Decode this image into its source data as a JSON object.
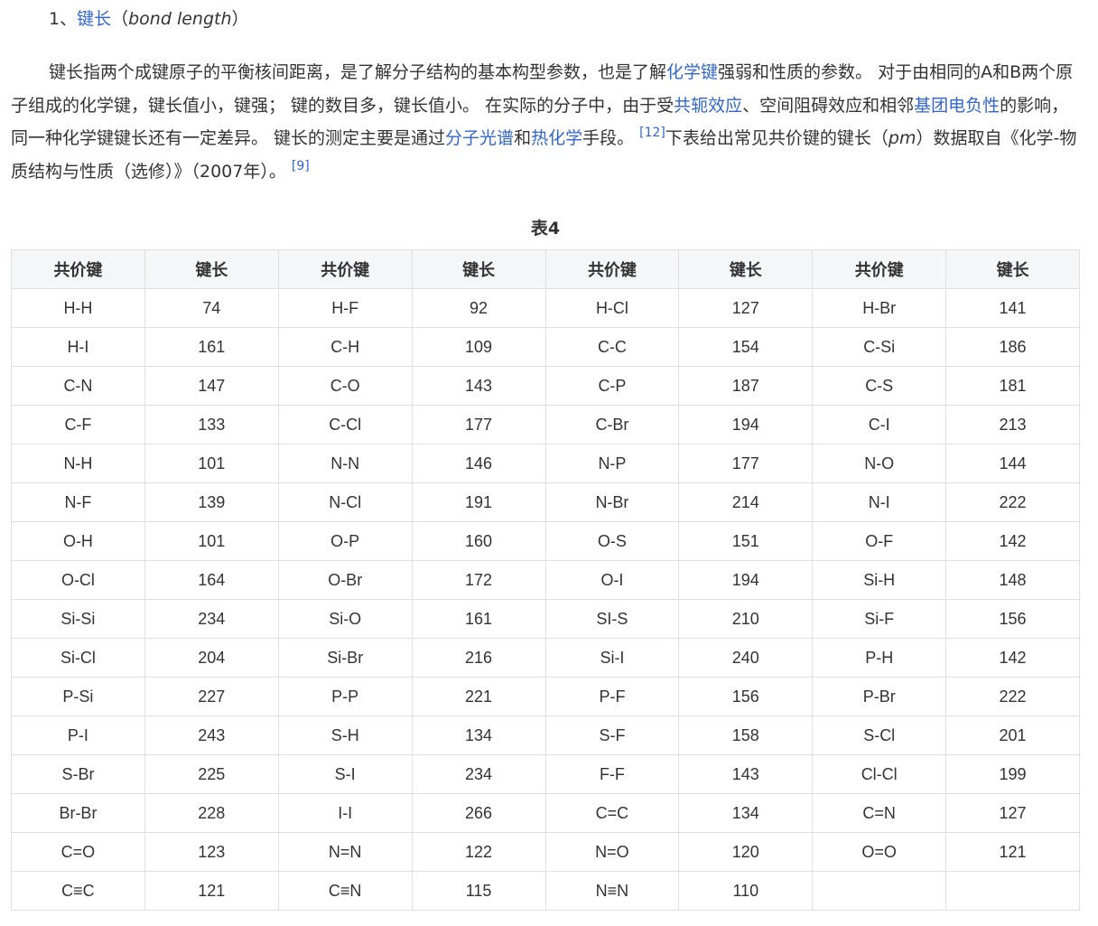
{
  "heading": {
    "number": "1、",
    "link": "键长",
    "open_paren": "（",
    "english": "bond length",
    "close_paren": "）"
  },
  "paragraph": {
    "t1": "键长指两个成键原子的平衡核间距离，是了解分子结构的基本构型参数，也是了解",
    "link1": "化学键",
    "t2": "强弱和性质的参数。 对于由相同的A和B两个原子组成的化学键，键长值小，键强； 键的数目多，键长值小。 在实际的分子中，由于受",
    "link2": "共轭效应",
    "t3": "、空间阻碍效应和相邻",
    "link3": "基团电负性",
    "t4": "的影响，同一种化学键键长还有一定差异。 键长的测定主要是通过",
    "link4": "分子光谱",
    "t5": "和",
    "link5": "热化学",
    "t6": "手段。 ",
    "ref1": "[12]",
    "t7": "下表给出常见共价键的键长（",
    "t7_italic": "pm",
    "t8": "）数据取自《化学-物质结构与性质（选修）》（2007年）。 ",
    "ref2": "[9]"
  },
  "table": {
    "caption": "表4",
    "headers": [
      "共价键",
      "键长",
      "共价键",
      "键长",
      "共价键",
      "键长",
      "共价键",
      "键长"
    ],
    "rows": [
      [
        "H-H",
        "74",
        "H-F",
        "92",
        "H-Cl",
        "127",
        "H-Br",
        "141"
      ],
      [
        "H-I",
        "161",
        "C-H",
        "109",
        "C-C",
        "154",
        "C-Si",
        "186"
      ],
      [
        "C-N",
        "147",
        "C-O",
        "143",
        "C-P",
        "187",
        "C-S",
        "181"
      ],
      [
        "C-F",
        "133",
        "C-Cl",
        "177",
        "C-Br",
        "194",
        "C-I",
        "213"
      ],
      [
        "N-H",
        "101",
        "N-N",
        "146",
        "N-P",
        "177",
        "N-O",
        "144"
      ],
      [
        "N-F",
        "139",
        "N-Cl",
        "191",
        "N-Br",
        "214",
        "N-I",
        "222"
      ],
      [
        "O-H",
        "101",
        "O-P",
        "160",
        "O-S",
        "151",
        "O-F",
        "142"
      ],
      [
        "O-Cl",
        "164",
        "O-Br",
        "172",
        "O-I",
        "194",
        "Si-H",
        "148"
      ],
      [
        "Si-Si",
        "234",
        "Si-O",
        "161",
        "SI-S",
        "210",
        "Si-F",
        "156"
      ],
      [
        "Si-Cl",
        "204",
        "Si-Br",
        "216",
        "Si-I",
        "240",
        "P-H",
        "142"
      ],
      [
        "P-Si",
        "227",
        "P-P",
        "221",
        "P-F",
        "156",
        "P-Br",
        "222"
      ],
      [
        "P-I",
        "243",
        "S-H",
        "134",
        "S-F",
        "158",
        "S-Cl",
        "201"
      ],
      [
        "S-Br",
        "225",
        "S-I",
        "234",
        "F-F",
        "143",
        "Cl-Cl",
        "199"
      ],
      [
        "Br-Br",
        "228",
        "I-I",
        "266",
        "C=C",
        "134",
        "C=N",
        "127"
      ],
      [
        "C=O",
        "123",
        "N=N",
        "122",
        "N=O",
        "120",
        "O=O",
        "121"
      ],
      [
        "C≡C",
        "121",
        "C≡N",
        "115",
        "N≡N",
        "110",
        "",
        ""
      ]
    ]
  },
  "colors": {
    "link": "#3366cc",
    "text": "#333333",
    "border": "#e0e0e0",
    "header_bg": "#f5f6f8"
  }
}
